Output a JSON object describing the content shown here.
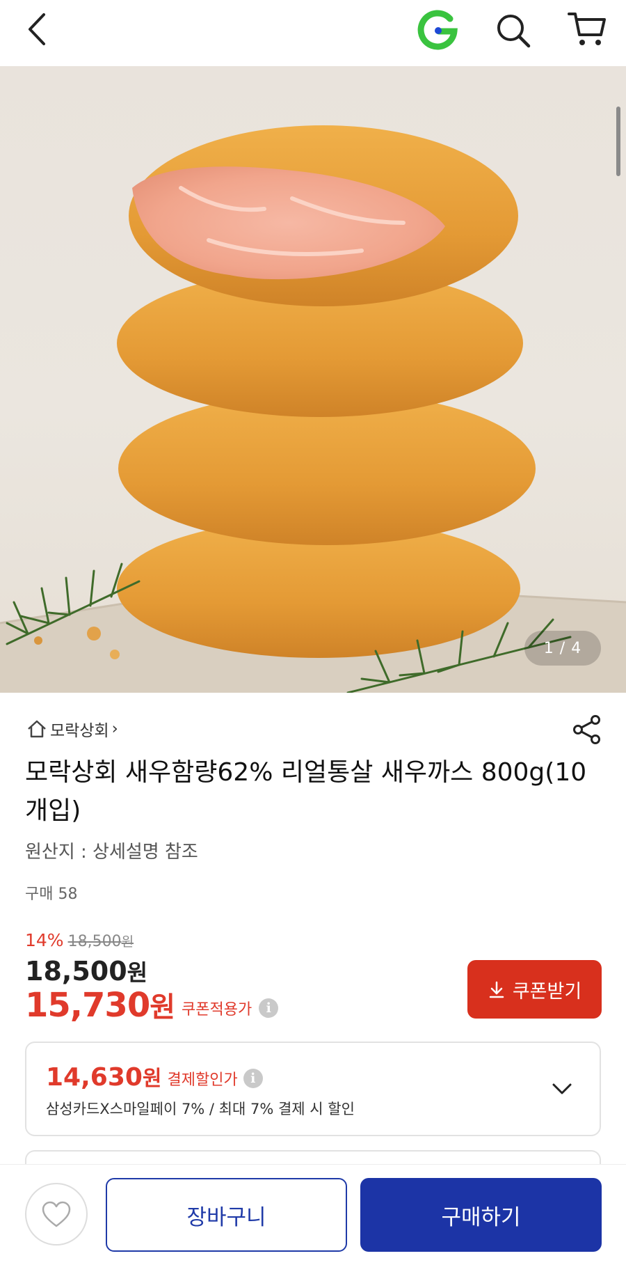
{
  "header": {
    "back_icon": "chevron-left-icon",
    "logo_icon": "gmarket-g-logo",
    "search_icon": "search-icon",
    "cart_icon": "cart-icon"
  },
  "gallery": {
    "counter": "1 / 4"
  },
  "store": {
    "name": "모락상회",
    "home_icon": "home-icon",
    "arrow": "›"
  },
  "product": {
    "title": "모락상회 새우함량62% 리얼통살 새우까스 800g(10개입)",
    "origin": "원산지 : 상세설명 참조",
    "purchase_count": "구매 58",
    "share_icon": "share-icon"
  },
  "price": {
    "discount_rate": "14%",
    "original_price": "18,500",
    "original_unit": "원",
    "sale_price": "18,500",
    "sale_unit": "원",
    "coupon_price": "15,730",
    "coupon_unit": "원",
    "coupon_label": "쿠폰적용가",
    "info_icon": "i",
    "coupon_button": "쿠폰받기",
    "accent_color": "#e03a2b"
  },
  "payment": {
    "price": "14,630",
    "unit": "원",
    "label": "결제할인가",
    "info_icon": "i",
    "description": "삼성카드X스마일페이 7% / 최대 7% 결제 시 할인"
  },
  "bottom_bar": {
    "wishlist_icon": "heart-icon",
    "cart_button": "장바구니",
    "buy_button": "구매하기",
    "brand_color": "#1c34a6"
  }
}
